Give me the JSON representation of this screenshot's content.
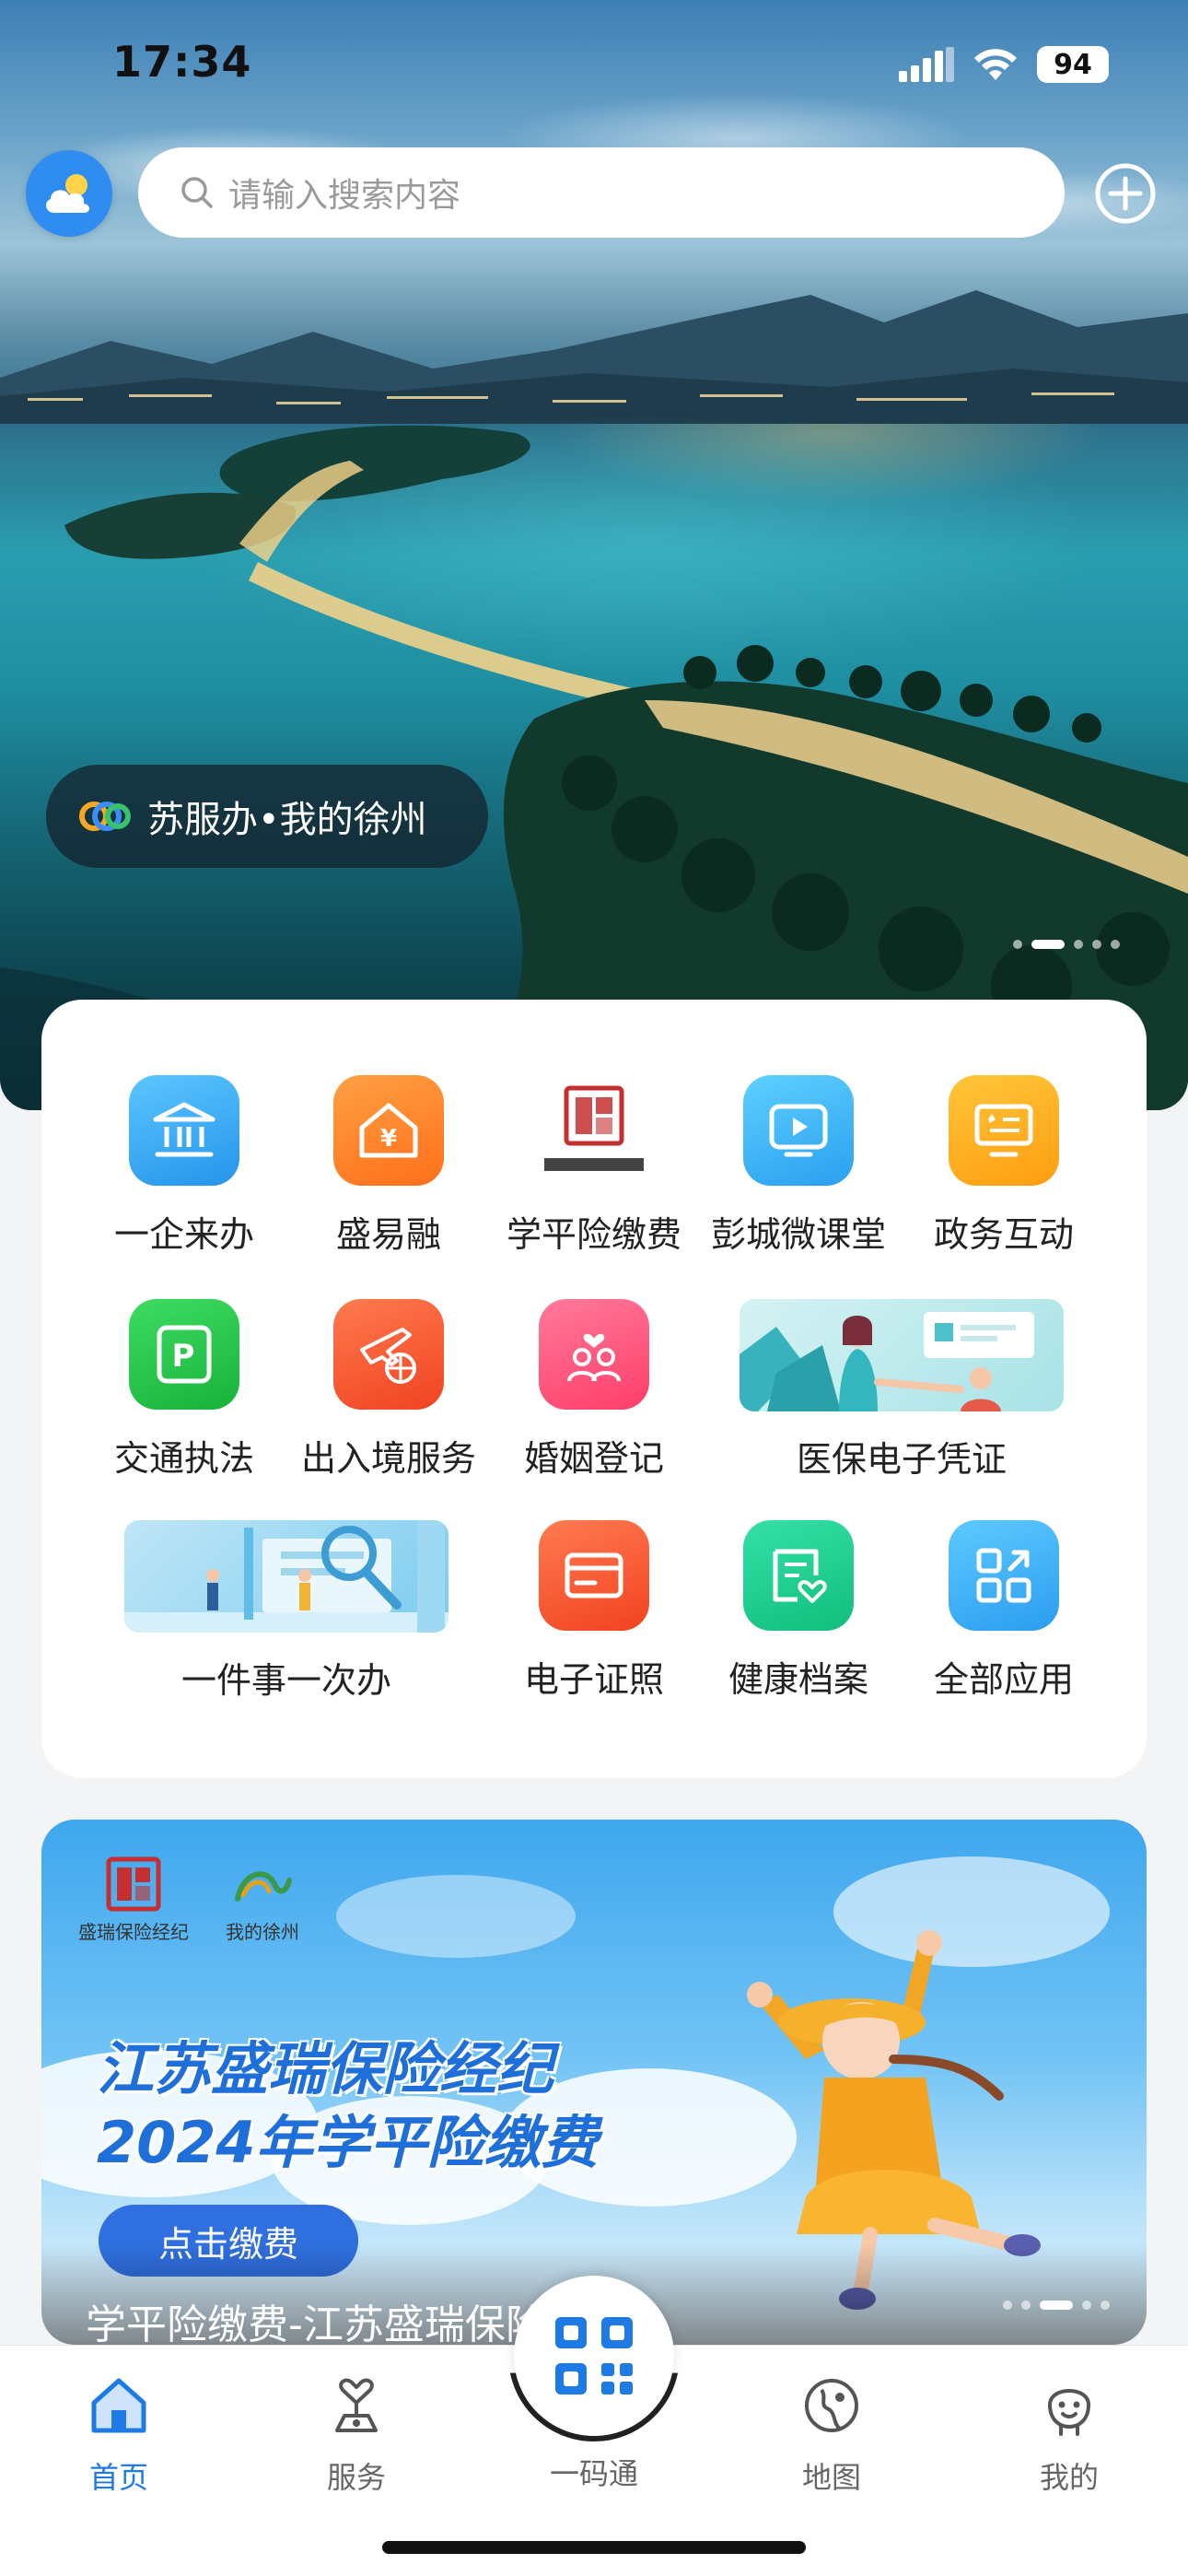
{
  "status_bar": {
    "time": "17:34",
    "battery": "94"
  },
  "search": {
    "placeholder": "请输入搜索内容"
  },
  "hero": {
    "brand": "苏服办•我的徐州"
  },
  "services": [
    {
      "label": "一企来办",
      "icon": "bank-icon",
      "color": "#36a9f2"
    },
    {
      "label": "盛易融",
      "icon": "house-yen-icon",
      "color": "#ff8a2a"
    },
    {
      "label": "学平险缴费",
      "icon": "shengrui-logo",
      "color": "#c62f2f"
    },
    {
      "label": "彭城微课堂",
      "icon": "video-play-icon",
      "color": "#31b4f5"
    },
    {
      "label": "政务互动",
      "icon": "monitor-exchange-icon",
      "color": "#ffb11f"
    },
    {
      "label": "交通执法",
      "icon": "parking-icon",
      "color": "#23c24b"
    },
    {
      "label": "出入境服务",
      "icon": "plane-globe-icon",
      "color": "#ff5a3a"
    },
    {
      "label": "婚姻登记",
      "icon": "couple-heart-icon",
      "color": "#ff5a80"
    },
    {
      "label": "医保电子凭证",
      "icon": "medical-illustration",
      "color": "#4fc0c9"
    },
    {
      "label": "一件事一次办",
      "icon": "search-illustration",
      "color": "#5fbde8"
    },
    {
      "label": "电子证照",
      "icon": "card-icon",
      "color": "#ff5b3a"
    },
    {
      "label": "健康档案",
      "icon": "health-record-icon",
      "color": "#1fcc8e"
    },
    {
      "label": "全部应用",
      "icon": "grid-apps-icon",
      "color": "#2fa9f3"
    }
  ],
  "promo": {
    "logo1_caption": "盛瑞保险经纪",
    "logo2_caption": "我的徐州",
    "title_line1": "江苏盛瑞保险经纪",
    "title_line2": "2024年学平险缴费",
    "button": "点击缴费",
    "caption": "学平险缴费-江苏盛瑞保险经纪"
  },
  "tabbar": {
    "tabs": [
      {
        "label": "首页",
        "icon": "home-icon"
      },
      {
        "label": "服务",
        "icon": "service-icon"
      },
      {
        "label": "一码通",
        "icon": "qr-code-icon"
      },
      {
        "label": "地图",
        "icon": "map-icon"
      },
      {
        "label": "我的",
        "icon": "profile-icon"
      }
    ],
    "active_color": "#1e7be6"
  }
}
